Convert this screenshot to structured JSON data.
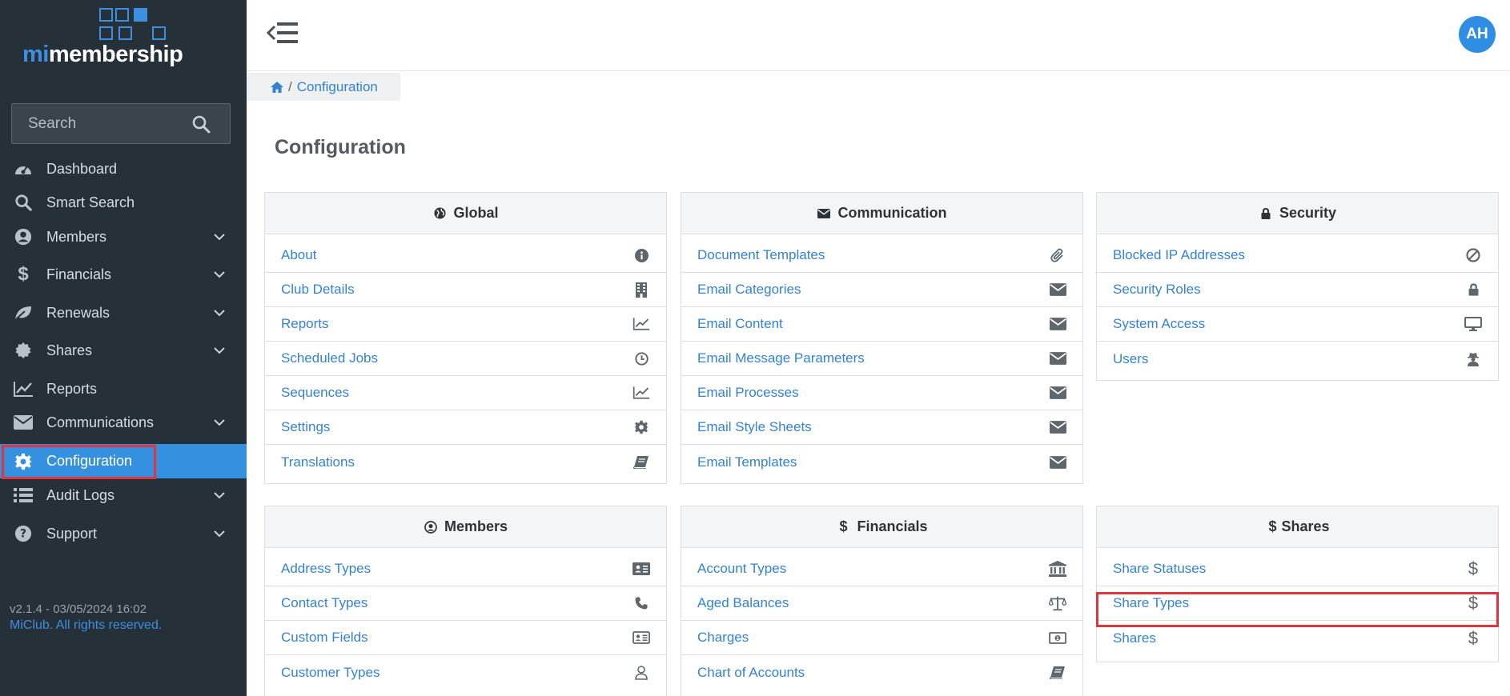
{
  "app": {
    "logo_prefix": "mi",
    "logo_suffix": "membership",
    "version": "v2.1.4 - 03/05/2024 16:02",
    "copyright": "MiClub. All rights reserved."
  },
  "search": {
    "placeholder": "Search",
    "value": ""
  },
  "sidebar": {
    "items": [
      {
        "label": "Dashboard",
        "icon": "dashboard-icon",
        "expandable": false
      },
      {
        "label": "Smart Search",
        "icon": "search-icon",
        "expandable": false
      },
      {
        "label": "Members",
        "icon": "user-icon",
        "expandable": true
      },
      {
        "label": "Financials",
        "icon": "dollar-icon",
        "expandable": true
      },
      {
        "label": "Renewals",
        "icon": "leaf-icon",
        "expandable": true
      },
      {
        "label": "Shares",
        "icon": "certificate-icon",
        "expandable": true
      },
      {
        "label": "Reports",
        "icon": "line-chart-icon",
        "expandable": false
      },
      {
        "label": "Communications",
        "icon": "envelope-icon",
        "expandable": true
      },
      {
        "label": "Configuration",
        "icon": "gear-icon",
        "expandable": false,
        "active": true
      },
      {
        "label": "Audit Logs",
        "icon": "list-icon",
        "expandable": true
      },
      {
        "label": "Support",
        "icon": "question-icon",
        "expandable": true
      }
    ]
  },
  "header": {
    "avatar_initials": "AH"
  },
  "breadcrumb": {
    "separator": "/",
    "current": "Configuration"
  },
  "page": {
    "title": "Configuration"
  },
  "panels": {
    "global": {
      "title": "Global",
      "items": [
        {
          "label": "About",
          "icon": "info-icon"
        },
        {
          "label": "Club Details",
          "icon": "building-icon"
        },
        {
          "label": "Reports",
          "icon": "line-chart-icon"
        },
        {
          "label": "Scheduled Jobs",
          "icon": "clock-icon"
        },
        {
          "label": "Sequences",
          "icon": "line-chart-icon"
        },
        {
          "label": "Settings",
          "icon": "gear-icon"
        },
        {
          "label": "Translations",
          "icon": "book-icon"
        }
      ]
    },
    "communication": {
      "title": "Communication",
      "items": [
        {
          "label": "Document Templates",
          "icon": "paperclip-icon"
        },
        {
          "label": "Email Categories",
          "icon": "envelope-icon"
        },
        {
          "label": "Email Content",
          "icon": "envelope-icon"
        },
        {
          "label": "Email Message Parameters",
          "icon": "envelope-icon"
        },
        {
          "label": "Email Processes",
          "icon": "envelope-icon"
        },
        {
          "label": "Email Style Sheets",
          "icon": "envelope-icon"
        },
        {
          "label": "Email Templates",
          "icon": "envelope-icon"
        }
      ]
    },
    "security": {
      "title": "Security",
      "items": [
        {
          "label": "Blocked IP Addresses",
          "icon": "ban-icon"
        },
        {
          "label": "Security Roles",
          "icon": "lock-icon"
        },
        {
          "label": "System Access",
          "icon": "monitor-icon"
        },
        {
          "label": "Users",
          "icon": "user-secret-icon"
        }
      ]
    },
    "members": {
      "title": "Members",
      "items": [
        {
          "label": "Address Types",
          "icon": "address-card-icon"
        },
        {
          "label": "Contact Types",
          "icon": "phone-icon"
        },
        {
          "label": "Custom Fields",
          "icon": "id-card-icon"
        },
        {
          "label": "Customer Types",
          "icon": "user-outline-icon"
        }
      ]
    },
    "financials": {
      "title": "Financials",
      "items": [
        {
          "label": "Account Types",
          "icon": "bank-icon"
        },
        {
          "label": "Aged Balances",
          "icon": "scale-icon"
        },
        {
          "label": "Charges",
          "icon": "money-icon"
        },
        {
          "label": "Chart of Accounts",
          "icon": "book-icon"
        }
      ]
    },
    "shares": {
      "title": "Shares",
      "items": [
        {
          "label": "Share Statuses",
          "icon": "dollar-icon"
        },
        {
          "label": "Share Types",
          "icon": "dollar-icon",
          "highlighted": true
        },
        {
          "label": "Shares",
          "icon": "dollar-icon"
        }
      ]
    }
  },
  "colors": {
    "sidebar_bg": "#263038",
    "accent": "#3590e0",
    "link": "#3582d0",
    "highlight_outline": "#e0353d"
  }
}
